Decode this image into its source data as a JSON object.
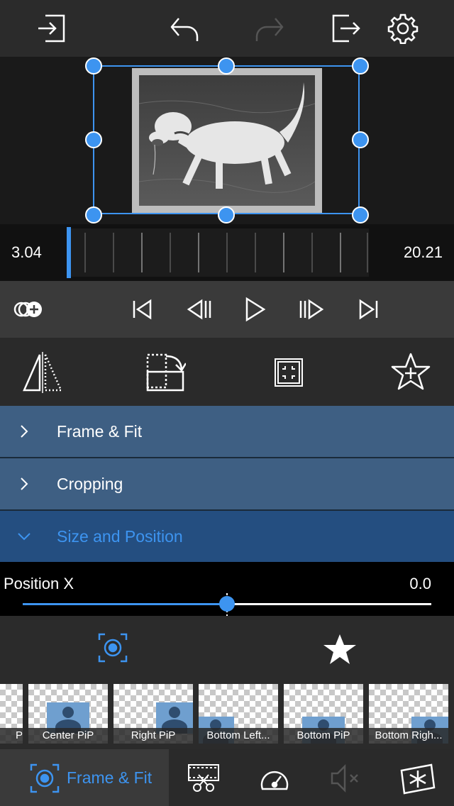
{
  "toolbar": {
    "import_icon": "import-icon",
    "undo_icon": "undo-icon",
    "redo_icon": "redo-icon",
    "export_icon": "export-icon",
    "settings_icon": "gear-icon"
  },
  "timeline": {
    "current_time": "3.04",
    "total_time": "20.21"
  },
  "sections": [
    {
      "label": "Frame & Fit",
      "expanded": false
    },
    {
      "label": "Cropping",
      "expanded": false
    },
    {
      "label": "Size and Position",
      "expanded": true
    }
  ],
  "slider": {
    "label": "Position X",
    "value": "0.0",
    "position_fraction": 0.5
  },
  "presets": [
    {
      "label": "P"
    },
    {
      "label": "Center PiP"
    },
    {
      "label": "Right PiP"
    },
    {
      "label": "Bottom Left..."
    },
    {
      "label": "Bottom PiP"
    },
    {
      "label": "Bottom Righ..."
    }
  ],
  "bottom_tabs": {
    "active_label": "Frame & Fit"
  },
  "colors": {
    "accent": "#3d94f0",
    "section_bg": "#3e5f83",
    "section_open_bg": "#244e80"
  }
}
